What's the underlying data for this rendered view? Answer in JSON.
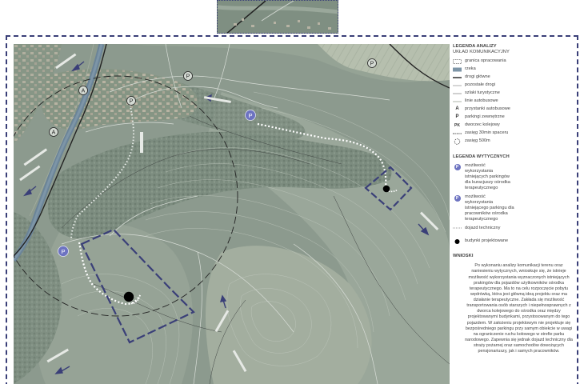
{
  "legend": {
    "title": "LEGENDA ANALIZY",
    "subtitle": "UKŁAD KOMUNIKACYJNY",
    "items": [
      {
        "key": "boundary",
        "label": "granica opracowania"
      },
      {
        "key": "river",
        "label": "rzeka"
      },
      {
        "key": "main_roads",
        "label": "drogi główne"
      },
      {
        "key": "other_roads",
        "label": "pozostałe drogi"
      },
      {
        "key": "tourist_trails",
        "label": "szlaki turystyczne"
      },
      {
        "key": "bus_lines",
        "label": "linie autobusowe"
      },
      {
        "key": "bus_stops",
        "label": "przystanki autobusowe",
        "glyph": "A"
      },
      {
        "key": "external_parking",
        "label": "parkingi zewnętrzne",
        "glyph": "P"
      },
      {
        "key": "railway_station",
        "label": "dworzec kolejowy",
        "glyph": "PK"
      },
      {
        "key": "walk_range",
        "label": "zasięg 30min spaceru"
      },
      {
        "key": "range_500",
        "label": "zasięg 500m"
      }
    ]
  },
  "guidelines": {
    "title": "LEGENDA WYTYCZNYCH",
    "items": [
      {
        "key": "parking_patients",
        "label": "możliwość wykorzystania istniejących parkingów dla kuracjuszy ośrodka terapeutycznego",
        "glyph": "P"
      },
      {
        "key": "parking_staff",
        "label": "możliwość wykorzystania istniejącego parkingu dla pracowników ośrodka terapeutycznego",
        "glyph": "P"
      },
      {
        "key": "technical_access",
        "label": "dojazd techniczny"
      },
      {
        "key": "designed_buildings",
        "label": "budynki projektowane"
      }
    ]
  },
  "conclusions": {
    "title": "WNIOSKI",
    "text": "Po wykonaniu analizy komunikacji terenu oraz naniesieniu wytycznych, wnioskuje się, że istnieje możliwość wykorzystania wyznaczonych istniejących prakingów dla pojazdów użytkowników ośrodka terapeutycznego. Ma to na celu rozpoczęcie pobytu wędrówką, która jest główną ideą projektu oraz ma działanie terapeutyczne. Zakłada się możliwość transportowania osób starszych i niepełnosprawnych z dworca kolejowego do ośrodka oraz między projektowanymi budynkami, przystosowanym do tego pojazdem. W założeniu projektowym nie projektuje się bezpośredniego parkingu przy samym obiekcie w uwagi na ograniczenie ruchu kołowego w strefie parku narodowego. Zapewnia się jednak dojazd techniczny dla straży pożarnej oraz samochodów dowożących pensjonariuszy, jak i samych pracowników."
  },
  "map": {
    "bus_stop_glyph": "A",
    "parking_glyph": "P",
    "colors": {
      "terrain": "#8a998d",
      "meadow": "#a4b2a3",
      "river": "#6d879c",
      "boundary": "#3a3f78",
      "parking_pin": "#6d73c1",
      "walk_path": "#ffffff",
      "building": "#000000"
    }
  }
}
